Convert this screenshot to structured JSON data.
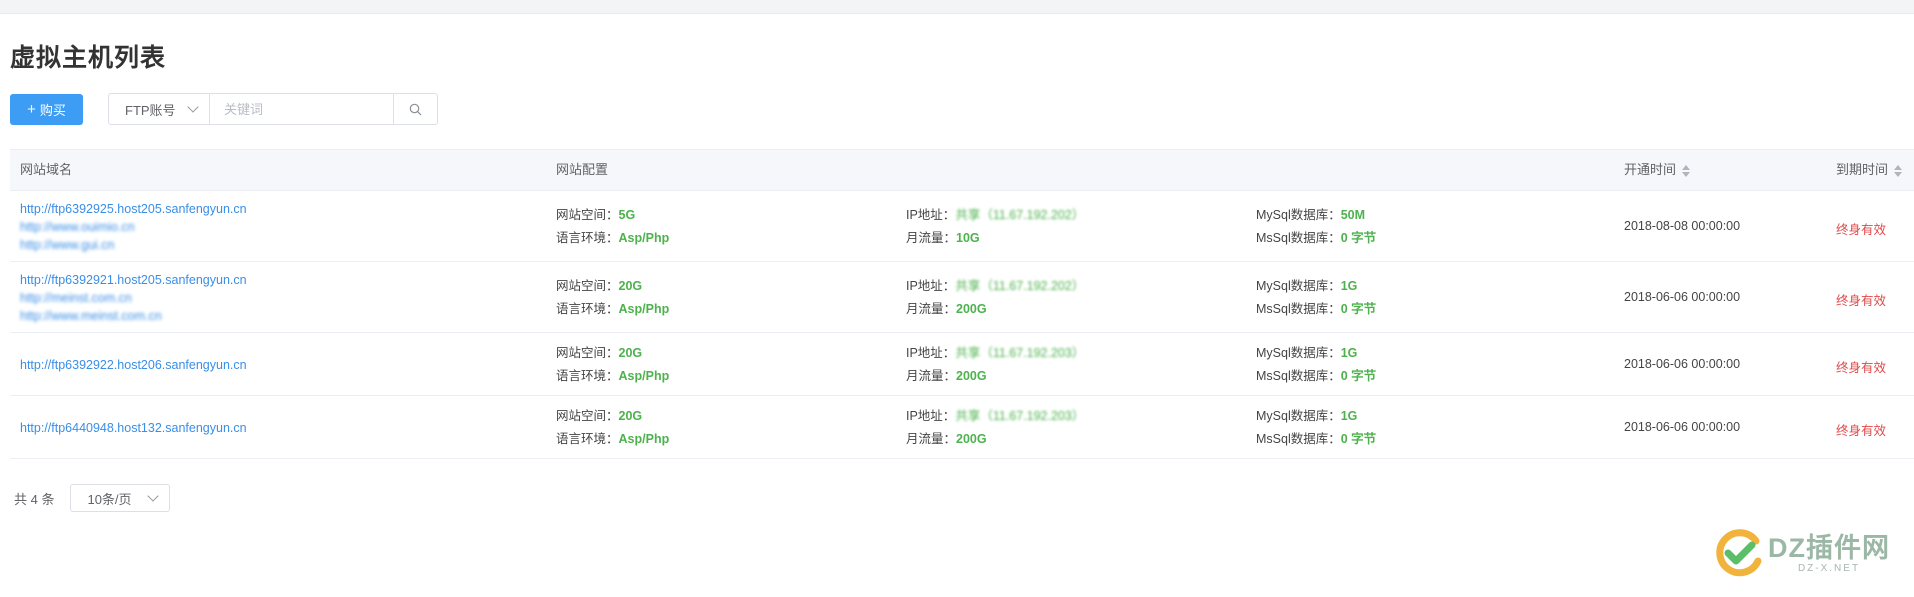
{
  "page_title": "虚拟主机列表",
  "toolbar": {
    "buy_label": "购买",
    "search_field": "FTP账号",
    "search_placeholder": "关键词"
  },
  "table": {
    "headers": {
      "domain": "网站域名",
      "config": "网站配置",
      "open_time": "开通时间",
      "expire_time": "到期时间"
    },
    "rows": [
      {
        "links": [
          "http://ftp6392925.host205.sanfengyun.cn",
          "http://www.ouimio.cn",
          "http://www.gui.cn"
        ],
        "space_label": "网站空间：",
        "space": "5G",
        "lang_label": "语言环境：",
        "lang": "Asp/Php",
        "ip_label": "IP地址：",
        "ip": "共享（11.67.192.202）",
        "traffic_label": "月流量：",
        "traffic": "10G",
        "mysql_label": "MySql数据库：",
        "mysql": "50M",
        "mssql_label": "MsSql数据库：",
        "mssql": "0 字节",
        "open_time": "2018-08-08 00:00:00",
        "expire": "终身有效"
      },
      {
        "links": [
          "http://ftp6392921.host205.sanfengyun.cn",
          "http://meinst.com.cn",
          "http://www.meinst.com.cn"
        ],
        "space_label": "网站空间：",
        "space": "20G",
        "lang_label": "语言环境：",
        "lang": "Asp/Php",
        "ip_label": "IP地址：",
        "ip": "共享（11.67.192.202）",
        "traffic_label": "月流量：",
        "traffic": "200G",
        "mysql_label": "MySql数据库：",
        "mysql": "1G",
        "mssql_label": "MsSql数据库：",
        "mssql": "0 字节",
        "open_time": "2018-06-06 00:00:00",
        "expire": "终身有效"
      },
      {
        "links": [
          "http://ftp6392922.host206.sanfengyun.cn"
        ],
        "space_label": "网站空间：",
        "space": "20G",
        "lang_label": "语言环境：",
        "lang": "Asp/Php",
        "ip_label": "IP地址：",
        "ip": "共享（11.67.192.203）",
        "traffic_label": "月流量：",
        "traffic": "200G",
        "mysql_label": "MySql数据库：",
        "mysql": "1G",
        "mssql_label": "MsSql数据库：",
        "mssql": "0 字节",
        "open_time": "2018-06-06 00:00:00",
        "expire": "终身有效"
      },
      {
        "links": [
          "http://ftp6440948.host132.sanfengyun.cn"
        ],
        "space_label": "网站空间：",
        "space": "20G",
        "lang_label": "语言环境：",
        "lang": "Asp/Php",
        "ip_label": "IP地址：",
        "ip": "共享（11.67.192.203）",
        "traffic_label": "月流量：",
        "traffic": "200G",
        "mysql_label": "MySql数据库：",
        "mysql": "1G",
        "mssql_label": "MsSql数据库：",
        "mssql": "0 字节",
        "open_time": "2018-06-06 00:00:00",
        "expire": "终身有效"
      }
    ]
  },
  "pager": {
    "total": "共 4 条",
    "page_size": "10条/页"
  },
  "watermark": {
    "main": "DZ插件网",
    "sub": "DZ-X.NET"
  },
  "colors": {
    "primary": "#3d9df5",
    "link": "#3a8ee6",
    "value_green": "#4db24d",
    "expire_red": "#e04a4a"
  }
}
